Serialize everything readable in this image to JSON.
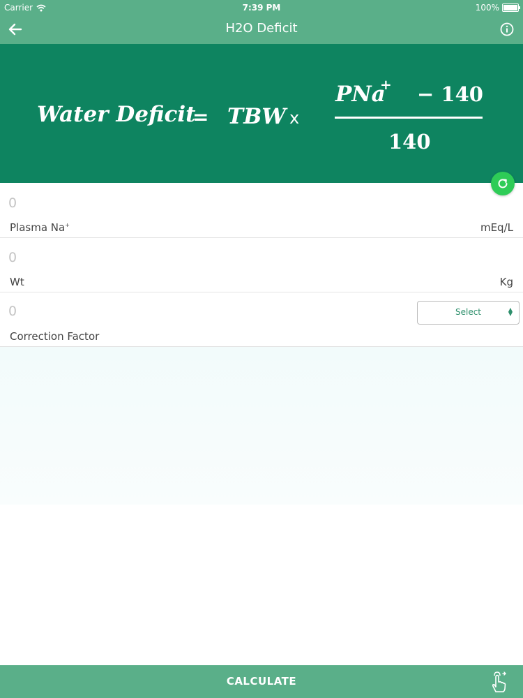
{
  "status_bar": {
    "carrier": "Carrier",
    "time": "7:39 PM",
    "battery": "100%"
  },
  "nav": {
    "title": "H2O Deficit",
    "back_icon": "arrow-left-icon",
    "info_icon": "info-icon"
  },
  "formula": {
    "lhs": "Water Deficit",
    "equals": "=",
    "tbw": "TBW",
    "times": "x",
    "numerator_var": "PNa",
    "numerator_sup": "+",
    "numerator_minus": "− 140",
    "denominator": "140"
  },
  "fields": {
    "plasma_na": {
      "value": "0",
      "label": "Plasma Na",
      "label_sup": "+",
      "unit": "mEq/L"
    },
    "wt": {
      "value": "0",
      "label": "Wt",
      "unit": "Kg"
    },
    "correction": {
      "value": "0",
      "label": "Correction Factor",
      "select_placeholder": "Select"
    }
  },
  "calculate": {
    "label": "CALCULATE",
    "icon": "tap-hand-icon"
  },
  "colors": {
    "header": "#5aaf89",
    "formula_bg": "#0e8460",
    "refresh_button": "#2ecc57",
    "accent_text": "#2e8f6c"
  }
}
